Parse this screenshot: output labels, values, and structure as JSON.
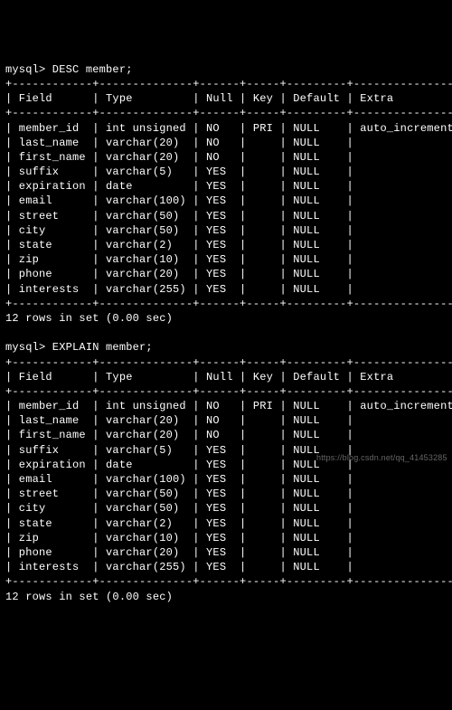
{
  "prompt": "mysql>",
  "commands": [
    {
      "cmd": "DESC member;"
    },
    {
      "cmd": "EXPLAIN member;"
    }
  ],
  "divider": "+------------+--------------+------+-----+---------+----------------+",
  "header": {
    "c0": "Field",
    "c1": "Type",
    "c2": "Null",
    "c3": "Key",
    "c4": "Default",
    "c5": "Extra"
  },
  "rows": [
    {
      "c0": "member_id",
      "c1": "int unsigned",
      "c2": "NO",
      "c3": "PRI",
      "c4": "NULL",
      "c5": "auto_increment"
    },
    {
      "c0": "last_name",
      "c1": "varchar(20)",
      "c2": "NO",
      "c3": "",
      "c4": "NULL",
      "c5": ""
    },
    {
      "c0": "first_name",
      "c1": "varchar(20)",
      "c2": "NO",
      "c3": "",
      "c4": "NULL",
      "c5": ""
    },
    {
      "c0": "suffix",
      "c1": "varchar(5)",
      "c2": "YES",
      "c3": "",
      "c4": "NULL",
      "c5": ""
    },
    {
      "c0": "expiration",
      "c1": "date",
      "c2": "YES",
      "c3": "",
      "c4": "NULL",
      "c5": ""
    },
    {
      "c0": "email",
      "c1": "varchar(100)",
      "c2": "YES",
      "c3": "",
      "c4": "NULL",
      "c5": ""
    },
    {
      "c0": "street",
      "c1": "varchar(50)",
      "c2": "YES",
      "c3": "",
      "c4": "NULL",
      "c5": ""
    },
    {
      "c0": "city",
      "c1": "varchar(50)",
      "c2": "YES",
      "c3": "",
      "c4": "NULL",
      "c5": ""
    },
    {
      "c0": "state",
      "c1": "varchar(2)",
      "c2": "YES",
      "c3": "",
      "c4": "NULL",
      "c5": ""
    },
    {
      "c0": "zip",
      "c1": "varchar(10)",
      "c2": "YES",
      "c3": "",
      "c4": "NULL",
      "c5": ""
    },
    {
      "c0": "phone",
      "c1": "varchar(20)",
      "c2": "YES",
      "c3": "",
      "c4": "NULL",
      "c5": ""
    },
    {
      "c0": "interests",
      "c1": "varchar(255)",
      "c2": "YES",
      "c3": "",
      "c4": "NULL",
      "c5": ""
    }
  ],
  "colWidths": {
    "c0": 10,
    "c1": 12,
    "c2": 4,
    "c3": 3,
    "c4": 7,
    "c5": 14
  },
  "summary": "12 rows in set (0.00 sec)",
  "watermark": "https://blog.csdn.net/qq_41453285"
}
